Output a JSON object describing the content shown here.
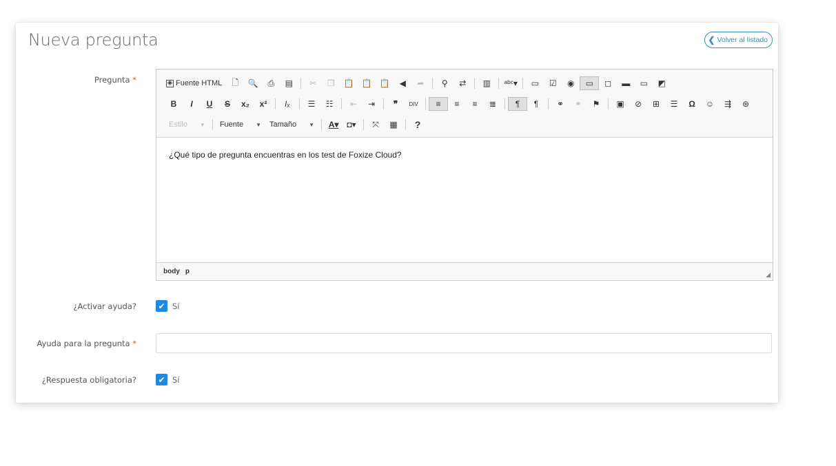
{
  "page": {
    "title": "Nueva pregunta",
    "back_label": "Volver al listado"
  },
  "form": {
    "question": {
      "label": "Pregunta",
      "required_mark": "*",
      "content": "¿Qué tipo de pregunta encuentras en los test de Foxize Cloud?"
    },
    "activate_help": {
      "label": "¿Activar ayuda?",
      "checked": true,
      "option_label": "Sí"
    },
    "help_text": {
      "label": "Ayuda para la pregunta",
      "required_mark": "*",
      "value": "",
      "placeholder": ""
    },
    "mandatory_answer": {
      "label": "¿Respuesta obligatoria?",
      "checked": true,
      "option_label": "Sí"
    }
  },
  "editor": {
    "source_label": "Fuente HTML",
    "style_combo": "Estilo",
    "font_combo": "Fuente",
    "size_combo": "Tamaño",
    "status_path": [
      "body",
      "p"
    ],
    "toolbar_icons_row1": [
      "source-icon",
      "new-page-icon",
      "preview-icon",
      "print-icon",
      "templates-icon",
      "cut-icon",
      "copy-icon",
      "paste-icon",
      "paste-text-icon",
      "paste-word-icon",
      "undo-icon",
      "redo-icon",
      "find-icon",
      "replace-icon",
      "select-all-icon",
      "spellcheck-icon",
      "form-icon",
      "checkbox-icon",
      "radio-icon",
      "textfield-icon",
      "textarea-icon",
      "select-icon",
      "button-icon",
      "imagebutton-icon"
    ],
    "toolbar_icons_row2": [
      "bold-icon",
      "italic-icon",
      "underline-icon",
      "strike-icon",
      "subscript-icon",
      "superscript-icon",
      "remove-format-icon",
      "numbered-list-icon",
      "bulleted-list-icon",
      "outdent-icon",
      "indent-icon",
      "blockquote-icon",
      "div-icon",
      "align-left-icon",
      "align-center-icon",
      "align-right-icon",
      "justify-icon",
      "ltr-icon",
      "rtl-icon",
      "link-icon",
      "unlink-icon",
      "anchor-icon",
      "image-icon",
      "flash-icon",
      "table-icon",
      "horizontal-rule-icon",
      "special-char-icon",
      "smiley-icon",
      "page-break-icon",
      "iframe-icon"
    ],
    "toolbar_icons_row3": [
      "text-color-icon",
      "bg-color-icon",
      "maximize-icon",
      "show-blocks-icon",
      "about-icon"
    ]
  },
  "colors": {
    "accent": "#3c8dbc",
    "checkbox": "#1e88e5",
    "required": "#e74c3c"
  }
}
